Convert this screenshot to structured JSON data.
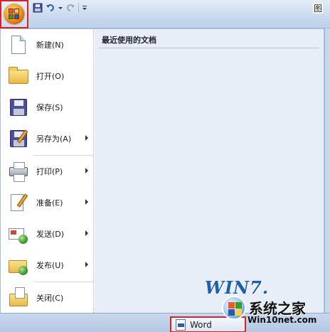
{
  "title_bar": {
    "right_text": "图"
  },
  "quick_access": {
    "items": [
      "save-icon",
      "undo-icon",
      "redo-icon",
      "customize-icon"
    ]
  },
  "menu": {
    "items": [
      {
        "label": "新建(N)",
        "icon": "new-document-icon",
        "has_submenu": false
      },
      {
        "label": "打开(O)",
        "icon": "open-folder-icon",
        "has_submenu": false
      },
      {
        "label": "保存(S)",
        "icon": "save-icon",
        "has_submenu": false
      },
      {
        "label": "另存为(A)",
        "icon": "save-as-icon",
        "has_submenu": true
      },
      {
        "label": "打印(P)",
        "icon": "print-icon",
        "has_submenu": true
      },
      {
        "label": "准备(E)",
        "icon": "prepare-icon",
        "has_submenu": true
      },
      {
        "label": "发送(D)",
        "icon": "send-icon",
        "has_submenu": true
      },
      {
        "label": "发布(U)",
        "icon": "publish-icon",
        "has_submenu": true
      },
      {
        "label": "关闭(C)",
        "icon": "close-folder-icon",
        "has_submenu": false
      }
    ],
    "recent_documents_title": "最近使用的文档"
  },
  "bottom": {
    "options_button_label": "Word"
  },
  "watermark": {
    "logo": "WIN7.",
    "chinese": "系统之家",
    "url": "Win10net.com"
  },
  "colors": {
    "highlight_border": "#d6232b",
    "recent_pane_bg": "#e7eef7",
    "office_orb": "#f6a21a"
  }
}
